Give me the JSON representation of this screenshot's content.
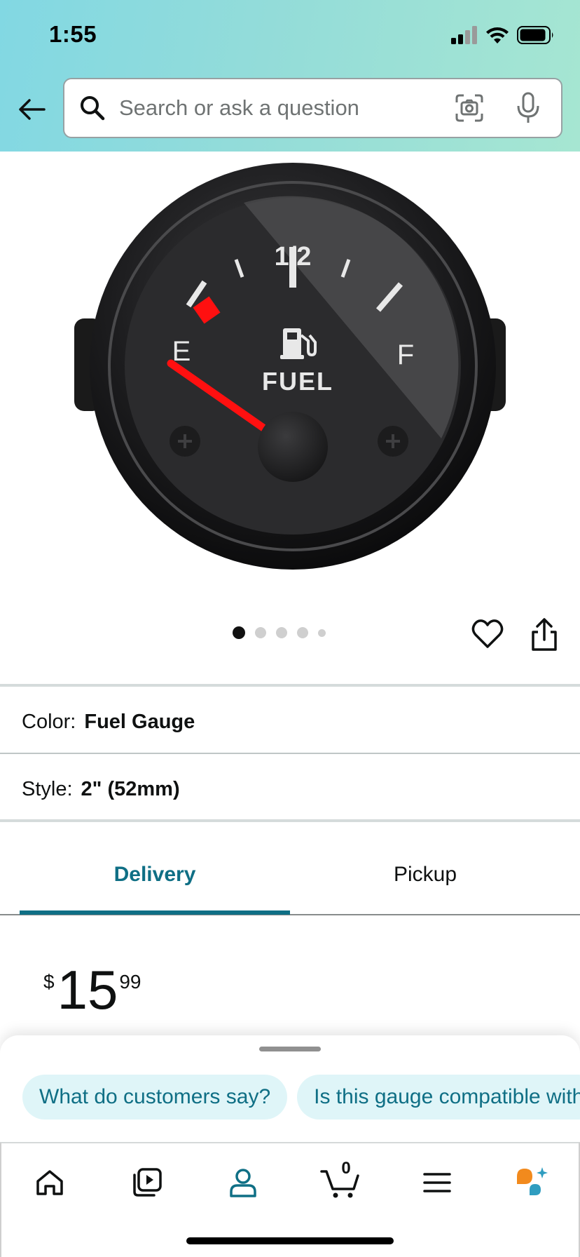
{
  "status_bar": {
    "time": "1:55"
  },
  "search": {
    "placeholder": "Search or ask a question"
  },
  "product": {
    "image_alt": "Fuel gauge",
    "gauge_labels": {
      "half": "1/2",
      "empty": "E",
      "full": "F",
      "word": "FUEL"
    },
    "carousel": {
      "count": 5,
      "active_index": 0
    }
  },
  "variations": [
    {
      "label": "Color:",
      "value": "Fuel Gauge"
    },
    {
      "label": "Style:",
      "value": "2\" (52mm)"
    }
  ],
  "tabs": {
    "delivery": "Delivery",
    "pickup": "Pickup",
    "active": "delivery"
  },
  "price": {
    "symbol": "$",
    "whole": "15",
    "fraction": "99"
  },
  "suggestions": [
    "What do customers say?",
    "Is this gauge compatible with"
  ],
  "nav": {
    "items": [
      "home-icon",
      "video-icon",
      "account-icon",
      "cart-icon",
      "menu-icon",
      "rufus-icon"
    ],
    "active": "account-icon",
    "cart_count": "0"
  },
  "colors": {
    "accent_teal": "#0f6f85",
    "chip_bg": "#dff5f8",
    "header_gradient_start": "#82d8e3",
    "header_gradient_end": "#a6e6d2",
    "needle_red": "#ff0000",
    "rufus_orange": "#f28a1d"
  }
}
